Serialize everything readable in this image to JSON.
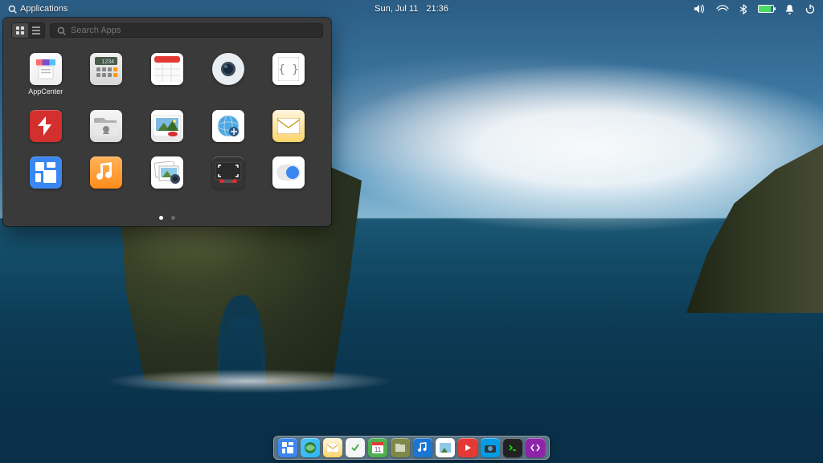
{
  "panel": {
    "applications_label": "Applications",
    "date": "Sun, Jul 11",
    "time": "21:36"
  },
  "launcher": {
    "search_placeholder": "Search Apps",
    "apps": [
      {
        "id": "appcenter",
        "label": "AppCenter"
      },
      {
        "id": "calculator",
        "label": "Calculator"
      },
      {
        "id": "calendar",
        "label": "Calendar"
      },
      {
        "id": "camera",
        "label": "Camera"
      },
      {
        "id": "code",
        "label": "Code"
      },
      {
        "id": "pdf",
        "label": "Document Viewer"
      },
      {
        "id": "files",
        "label": "Files"
      },
      {
        "id": "image",
        "label": "Image Viewer"
      },
      {
        "id": "web",
        "label": "Web"
      },
      {
        "id": "mail",
        "label": "Mail"
      },
      {
        "id": "tile",
        "label": "Multitasking"
      },
      {
        "id": "music",
        "label": "Music"
      },
      {
        "id": "photos",
        "label": "Photos"
      },
      {
        "id": "screenshot",
        "label": "Screenshot"
      },
      {
        "id": "settings",
        "label": "System Settings"
      }
    ],
    "pages": 2,
    "current_page": 1
  },
  "dock": {
    "items": [
      {
        "id": "multitask",
        "name": "multitasking"
      },
      {
        "id": "web",
        "name": "web-browser"
      },
      {
        "id": "mail",
        "name": "mail"
      },
      {
        "id": "tasks",
        "name": "tasks"
      },
      {
        "id": "calendar",
        "name": "calendar"
      },
      {
        "id": "files",
        "name": "files"
      },
      {
        "id": "music",
        "name": "music"
      },
      {
        "id": "photos",
        "name": "photos"
      },
      {
        "id": "videos",
        "name": "videos"
      },
      {
        "id": "camera",
        "name": "camera"
      },
      {
        "id": "terminal",
        "name": "terminal"
      },
      {
        "id": "code",
        "name": "code"
      }
    ]
  }
}
